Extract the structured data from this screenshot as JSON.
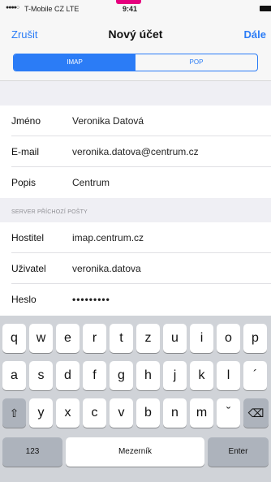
{
  "status_bar": {
    "signal": "●●●●○",
    "carrier": "T-Mobile CZ  LTE",
    "time": "9:41"
  },
  "nav": {
    "cancel": "Zrušit",
    "title": "Nový účet",
    "next": "Dále"
  },
  "segments": [
    {
      "label": "IMAP",
      "active": true
    },
    {
      "label": "POP",
      "active": false
    }
  ],
  "account": [
    {
      "label": "Jméno",
      "value": "Veronika Datová"
    },
    {
      "label": "E-mail",
      "value": "veronika.datova@centrum.cz"
    },
    {
      "label": "Popis",
      "value": "Centrum"
    }
  ],
  "incoming_header": "SERVER PŘÍCHOZÍ POŠTY",
  "incoming": [
    {
      "label": "Hostitel",
      "value": "imap.centrum.cz"
    },
    {
      "label": "Uživatel",
      "value": "veronika.datova"
    },
    {
      "label": "Heslo",
      "value": "•••••••••"
    }
  ],
  "keyboard": {
    "row1": [
      "q",
      "w",
      "e",
      "r",
      "t",
      "z",
      "u",
      "i",
      "o",
      "p"
    ],
    "row2": [
      "a",
      "s",
      "d",
      "f",
      "g",
      "h",
      "j",
      "k",
      "l",
      "´"
    ],
    "row3": [
      "y",
      "x",
      "c",
      "v",
      "b",
      "n",
      "m",
      "ˇ"
    ],
    "shift": "⇧",
    "delete": "⌫",
    "numbers": "123",
    "space": "Mezerník",
    "enter": "Enter"
  }
}
